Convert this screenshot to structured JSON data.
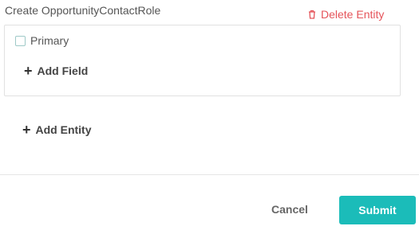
{
  "entity": {
    "title": "Create OpportunityContactRole",
    "delete_label": "Delete Entity",
    "delete_icon": "trash-icon",
    "fields": [
      {
        "label": "Primary",
        "checked": false
      }
    ],
    "add_field_label": "Add Field"
  },
  "actions": {
    "add_entity_label": "Add Entity",
    "cancel_label": "Cancel",
    "submit_label": "Submit"
  },
  "colors": {
    "accent": "#1bbcb9",
    "danger": "#e5545a"
  }
}
